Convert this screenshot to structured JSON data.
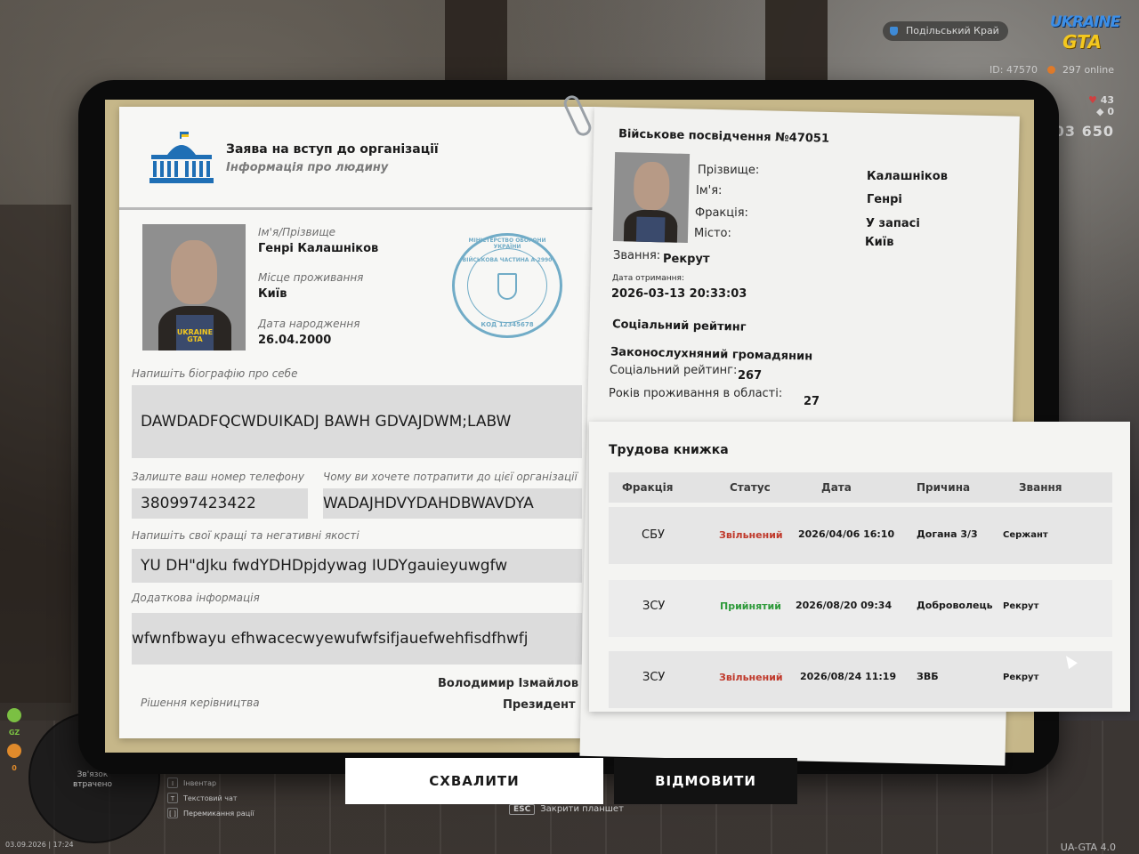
{
  "hud": {
    "region": "Подільський Край",
    "logo_top": "UKRAINE",
    "logo_bottom": "GTA",
    "player_id": "ID: 47570",
    "online": "297 online",
    "stat1": "43",
    "stat2": "0",
    "money": "03 650",
    "radar_status": "Зв'язок втрачено",
    "radar_icons": [
      "GZ",
      "0"
    ],
    "keys": [
      {
        "key": "I",
        "label": "Інвентар"
      },
      {
        "key": "T",
        "label": "Текстовий чат"
      },
      {
        "key": "[ ]",
        "label": "Перемикання рації"
      }
    ],
    "esc_key": "ESC",
    "esc_label": "Закрити планшет",
    "datetime": "03.09.2026 | 17:24",
    "version": "UA-GTA 4.0"
  },
  "application": {
    "title": "Заява на вступ до організації",
    "subtitle": "Інформація про людину",
    "name_label": "Ім'я/Прізвище",
    "name_value": "Генрі Калашніков",
    "residence_label": "Місце проживання",
    "residence_value": "Київ",
    "birth_label": "Дата народження",
    "birth_value": "26.04.2000",
    "shirt_text": "UKRAINE GTA",
    "stamp_top": "МІНІСТЕРСТВО ОБОРОНИ УКРАЇНИ",
    "stamp_middle": "ВІЙСЬКОВА ЧАСТИНА А-2990",
    "stamp_bottom": "КОД 12345678",
    "bio_label": "Напишіть біографію про себе",
    "bio_value": "DAWDADFQCWDUIKADJ BAWH GDVAJDWM;LABW",
    "phone_label": "Залиште ваш номер телефону",
    "phone_value": "380997423422",
    "reason_label": "Чому ви хочете потрапити до цієї організації",
    "reason_value": "WADAJHDVYDAHDBWAVDYA",
    "qualities_label": "Напишіть свої кращі та негативні якості",
    "qualities_value": "YU DH\"dJku fwdYDHDpjdywag IUDYgauieyuwgfw",
    "extra_label": "Додаткова інформація",
    "extra_value": "wfwnfbwayu efhwacecwyewufwfsifjauefwehfisdfhwfj",
    "signer_name": "Володимир Ізмайлов",
    "signer_title": "Президент",
    "decision_label": "Рішення керівництва"
  },
  "military_id": {
    "title": "Військове посвідчення №47051",
    "surname_label": "Прізвище:",
    "surname_value": "Калашніков",
    "name_label": "Ім'я:",
    "name_value": "Генрі",
    "faction_label": "Фракція:",
    "faction_value": "У запасі",
    "city_label": "Місто:",
    "city_value": "Київ",
    "rank_label": "Звання:",
    "rank_value": "Рекрут",
    "issued_label": "Дата отримання:",
    "issued_value": "2026-03-13 20:33:03",
    "social_title": "Соціальний рейтинг",
    "social_status": "Законослухняний громадянин",
    "rating_label": "Соціальний рейтинг:",
    "rating_value": "267",
    "years_label": "Років проживання в області:",
    "years_value": "27"
  },
  "work_book": {
    "title": "Трудова книжка",
    "columns": [
      "Фракція",
      "Статус",
      "Дата",
      "Причина",
      "Звання"
    ],
    "rows": [
      {
        "faction": "СБУ",
        "status": "Звільнений",
        "status_color": "#c0392b",
        "date": "2026/04/06 16:10",
        "reason": "Догана 3/3",
        "rank": "Сержант"
      },
      {
        "faction": "ЗСУ",
        "status": "Прийнятий",
        "status_color": "#2e9a3a",
        "date": "2026/08/20 09:34",
        "reason": "Доброволець",
        "rank": "Рекрут"
      },
      {
        "faction": "ЗСУ",
        "status": "Звільнений",
        "status_color": "#c0392b",
        "date": "2026/08/24 11:19",
        "reason": "ЗВБ",
        "rank": "Рекрут"
      }
    ]
  },
  "actions": {
    "approve": "СХВАЛИТИ",
    "reject": "ВІДМОВИТИ"
  }
}
